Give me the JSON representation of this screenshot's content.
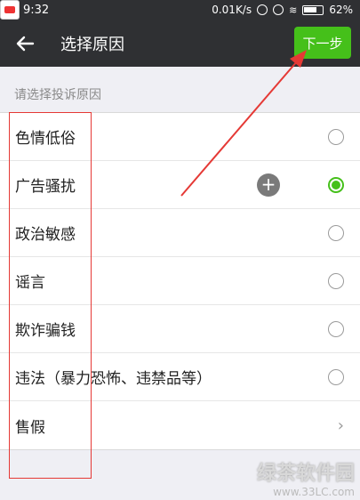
{
  "status_bar": {
    "time": "9:32",
    "network_speed": "0.01K/s",
    "battery": "62%"
  },
  "header": {
    "back_icon": "arrow-left-icon",
    "title": "选择原因",
    "next_label": "下一步"
  },
  "section_header": "请选择投诉原因",
  "reasons": [
    {
      "label": "色情低俗",
      "control": "radio",
      "selected": false
    },
    {
      "label": "广告骚扰",
      "control": "radio",
      "selected": true
    },
    {
      "label": "政治敏感",
      "control": "radio",
      "selected": false
    },
    {
      "label": "谣言",
      "control": "radio",
      "selected": false
    },
    {
      "label": "欺诈骗钱",
      "control": "radio",
      "selected": false
    },
    {
      "label": "违法（暴力恐怖、违禁品等）",
      "control": "radio",
      "selected": false
    },
    {
      "label": "售假",
      "control": "chevron",
      "selected": false
    }
  ],
  "watermark": {
    "main": "绿茶软件园",
    "url": "www.33LC.com"
  },
  "colors": {
    "accent": "#45c01a",
    "header_bg": "#2f3033",
    "annotation": "#e53935"
  }
}
